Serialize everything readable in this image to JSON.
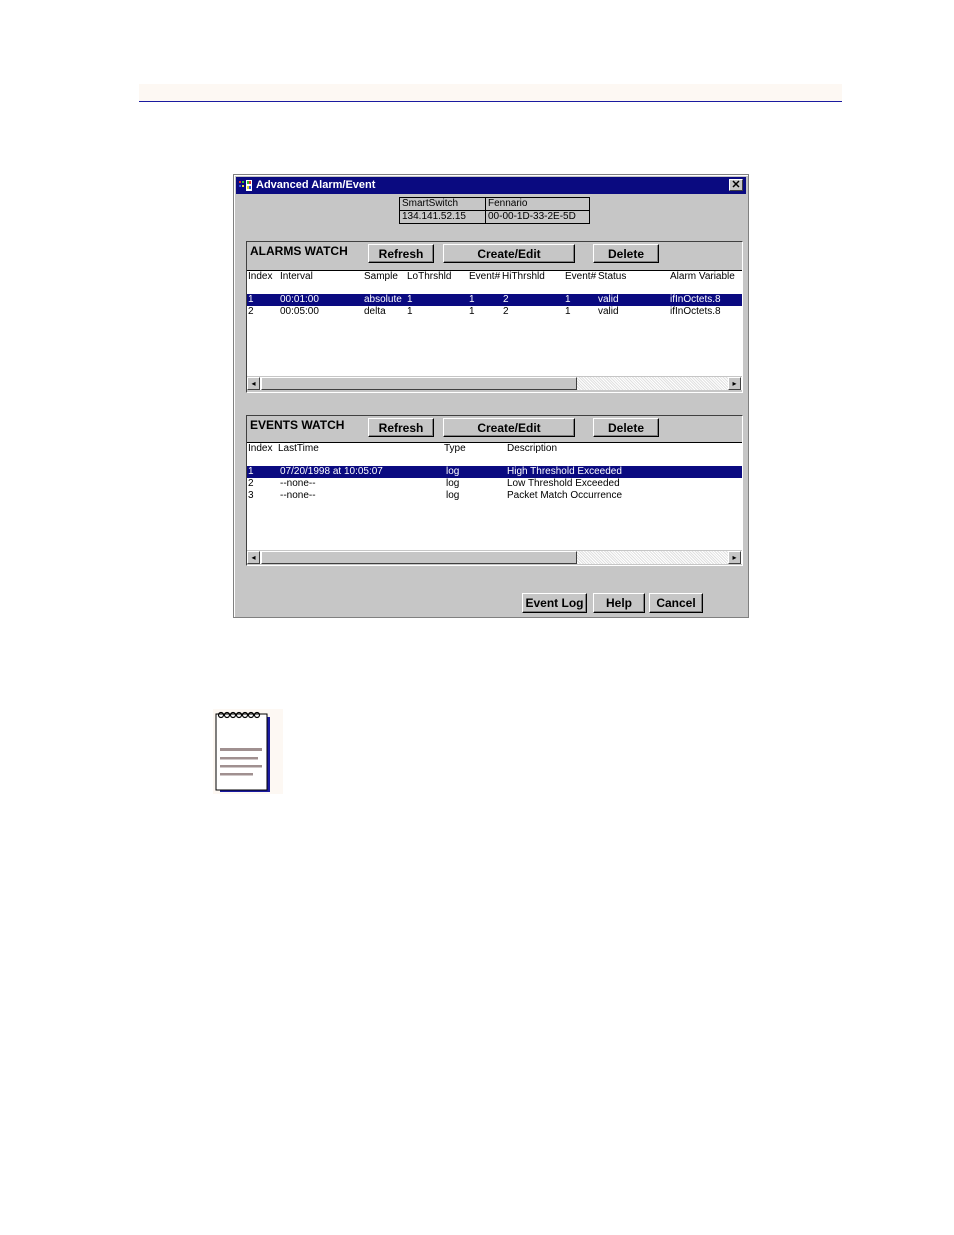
{
  "window": {
    "title": "Advanced Alarm/Event",
    "close_label": "✕"
  },
  "device_info": {
    "row1": [
      "SmartSwitch",
      "Fennario"
    ],
    "row2": [
      "134.141.52.15",
      "00-00-1D-33-2E-5D"
    ]
  },
  "alarms": {
    "label": "ALARMS WATCH",
    "buttons": {
      "refresh": "Refresh",
      "create_edit": "Create/Edit",
      "delete": "Delete"
    },
    "columns": [
      "Index",
      "Interval",
      "Sample",
      "LoThrshld",
      "Event#",
      "HiThrshld",
      "Event#",
      "Status",
      "Alarm Variable"
    ],
    "rows": [
      {
        "selected": true,
        "cells": [
          "1",
          "00:01:00",
          "absolute",
          "1",
          "1",
          "2",
          "1",
          "valid",
          "ifInOctets.8"
        ]
      },
      {
        "selected": false,
        "cells": [
          "2",
          "00:05:00",
          "delta",
          "1",
          "1",
          "2",
          "1",
          "valid",
          "ifInOctets.8"
        ]
      }
    ]
  },
  "events": {
    "label": "EVENTS WATCH",
    "buttons": {
      "refresh": "Refresh",
      "create_edit": "Create/Edit",
      "delete": "Delete"
    },
    "columns": [
      "Index",
      "LastTime",
      "Type",
      "Description"
    ],
    "rows": [
      {
        "selected": true,
        "cells": [
          "1",
          "07/20/1998 at 10:05:07",
          "log",
          "High Threshold Exceeded"
        ]
      },
      {
        "selected": false,
        "cells": [
          "2",
          "--none--",
          "log",
          "Low Threshold Exceeded"
        ]
      },
      {
        "selected": false,
        "cells": [
          "3",
          "--none--",
          "log",
          "Packet Match Occurrence"
        ]
      }
    ]
  },
  "footer": {
    "event_log": "Event Log",
    "help": "Help",
    "cancel": "Cancel"
  },
  "scroll": {
    "left_arrow": "◂",
    "right_arrow": "▸"
  },
  "colors": {
    "selection": "#0a0a80",
    "titlebar": "#0a0a80",
    "window_bg": "#c6c6c6",
    "page_rule": "#1a1aa0"
  }
}
